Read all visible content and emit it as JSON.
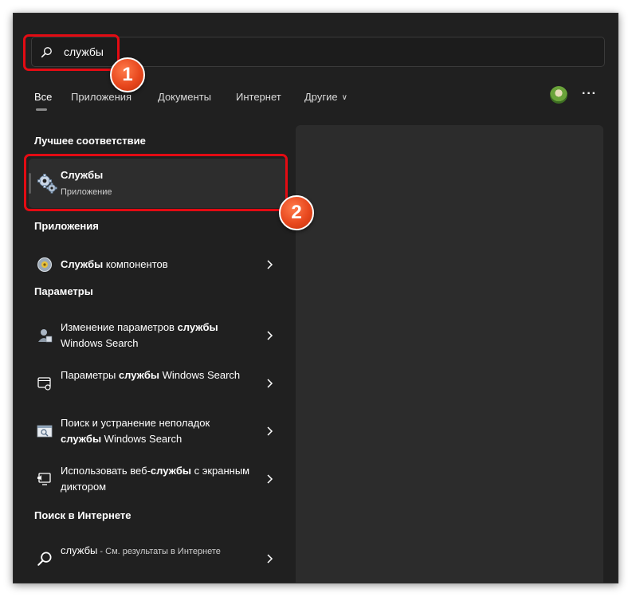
{
  "search": {
    "value": "службы",
    "icon": "search-icon"
  },
  "tabs": [
    {
      "label": "Все"
    },
    {
      "label": "Приложения"
    },
    {
      "label": "Документы"
    },
    {
      "label": "Интернет"
    },
    {
      "label": "Другие"
    }
  ],
  "header": {
    "more_label": "···"
  },
  "best_match": {
    "heading": "Лучшее соответствие",
    "title": "Службы",
    "subtitle": "Приложение",
    "icon": "gears-icon"
  },
  "apps": {
    "heading": "Приложения",
    "items": [
      {
        "pre": "",
        "bold": "Службы",
        "post": " компонентов",
        "icon": "component-services-icon"
      }
    ]
  },
  "settings": {
    "heading": "Параметры",
    "items": [
      {
        "pre": "Изменение параметров ",
        "bold": "службы",
        "post": " Windows Search",
        "icon": "user-settings-icon"
      },
      {
        "pre": "Параметры ",
        "bold": "службы",
        "post": " Windows Search",
        "icon": "window-settings-icon"
      },
      {
        "pre": "Поиск и устранение неполадок ",
        "bold": "службы",
        "post": " Windows Search",
        "icon": "troubleshoot-icon"
      },
      {
        "pre": "Использовать веб-",
        "bold": "службы",
        "post": " с экранным диктором",
        "icon": "narrator-icon"
      }
    ]
  },
  "web": {
    "heading": "Поиск в Интернете",
    "query": "службы",
    "suffix": " - См. результаты в Интернете",
    "icon": "search-icon"
  },
  "annotations": {
    "badge1": "1",
    "badge2": "2",
    "color": "#e30b13"
  }
}
